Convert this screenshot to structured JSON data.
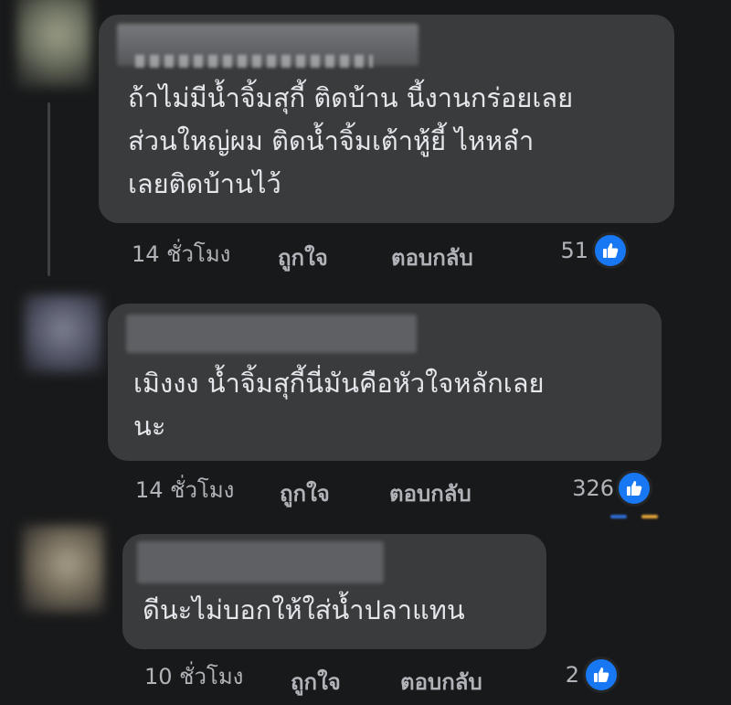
{
  "comments": [
    {
      "author": "",
      "text_lines": [
        "ถ้าไม่มีน้ำจิ้มสุกี้ ติดบ้าน นี้งานกร่อยเลย",
        "ส่วนใหญ่ผม ติดน้ำจิ้มเต้าหู้ยี้ ไหหลำ",
        "เลยติดบ้านไว้"
      ],
      "time": "14 ชั่วโมง",
      "like_label": "ถูกใจ",
      "reply_label": "ตอบกลับ",
      "reaction_count": "51",
      "reaction_icon": "thumbs-up-icon"
    },
    {
      "author": "",
      "text_lines": [
        "เมิงงง น้ำจิ้มสุกี้นี่มันคือหัวใจหลักเลย",
        "นะ"
      ],
      "time": "14 ชั่วโมง",
      "like_label": "ถูกใจ",
      "reply_label": "ตอบกลับ",
      "reaction_count": "326",
      "reaction_icon": "thumbs-up-icon"
    },
    {
      "author": "",
      "text_lines": [
        "ดีนะไม่บอกให้ใส่น้ำปลาแทน"
      ],
      "time": "10 ชั่วโมง",
      "like_label": "ถูกใจ",
      "reply_label": "ตอบกลับ",
      "reaction_count": "2",
      "reaction_icon": "thumbs-up-icon"
    }
  ],
  "colors": {
    "background": "#18191a",
    "bubble": "#3a3b3c",
    "text_primary": "#e4e6eb",
    "text_secondary": "#b0b3b8",
    "like_blue": "#1877f2"
  }
}
